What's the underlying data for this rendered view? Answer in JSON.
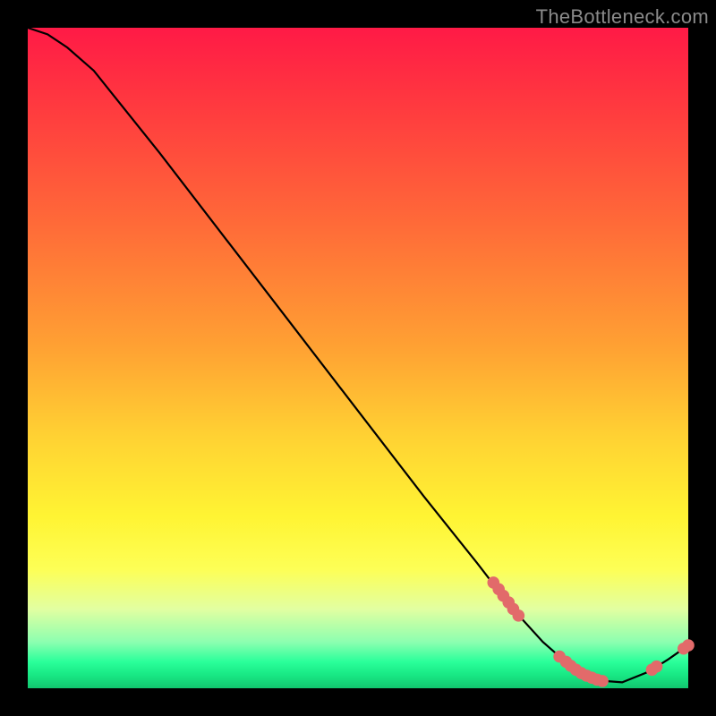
{
  "watermark": "TheBottleneck.com",
  "chart_data": {
    "type": "line",
    "title": "",
    "xlabel": "",
    "ylabel": "",
    "xlim": [
      0,
      100
    ],
    "ylim": [
      0,
      100
    ],
    "grid": false,
    "legend": false,
    "description": "Bottleneck-percentage curve on a red→green vertical gradient. Curve drops from top-left toward ~x=88 where it bottoms out near 0, then rises slightly.",
    "curve": [
      {
        "x": 0,
        "y": 100
      },
      {
        "x": 3,
        "y": 99
      },
      {
        "x": 6,
        "y": 97
      },
      {
        "x": 10,
        "y": 93.5
      },
      {
        "x": 20,
        "y": 81
      },
      {
        "x": 30,
        "y": 68
      },
      {
        "x": 40,
        "y": 55
      },
      {
        "x": 50,
        "y": 42
      },
      {
        "x": 60,
        "y": 29
      },
      {
        "x": 68,
        "y": 19
      },
      {
        "x": 73,
        "y": 12.5
      },
      {
        "x": 78,
        "y": 7
      },
      {
        "x": 82,
        "y": 3.5
      },
      {
        "x": 86,
        "y": 1.2
      },
      {
        "x": 90,
        "y": 0.9
      },
      {
        "x": 94,
        "y": 2.5
      },
      {
        "x": 97,
        "y": 4.4
      },
      {
        "x": 100,
        "y": 6.5
      }
    ],
    "series": [
      {
        "name": "markers",
        "points": [
          {
            "x": 70.5,
            "y": 16.0
          },
          {
            "x": 71.3,
            "y": 15.0
          },
          {
            "x": 72.0,
            "y": 14.0
          },
          {
            "x": 72.8,
            "y": 13.0
          },
          {
            "x": 73.5,
            "y": 12.0
          },
          {
            "x": 74.3,
            "y": 11.0
          },
          {
            "x": 80.5,
            "y": 4.8
          },
          {
            "x": 81.5,
            "y": 4.0
          },
          {
            "x": 82.2,
            "y": 3.4
          },
          {
            "x": 83.0,
            "y": 2.8
          },
          {
            "x": 83.8,
            "y": 2.3
          },
          {
            "x": 84.6,
            "y": 1.9
          },
          {
            "x": 85.4,
            "y": 1.6
          },
          {
            "x": 86.2,
            "y": 1.3
          },
          {
            "x": 87.0,
            "y": 1.1
          },
          {
            "x": 94.5,
            "y": 2.8
          },
          {
            "x": 95.2,
            "y": 3.3
          },
          {
            "x": 99.3,
            "y": 6.0
          },
          {
            "x": 100.0,
            "y": 6.5
          }
        ]
      }
    ]
  }
}
